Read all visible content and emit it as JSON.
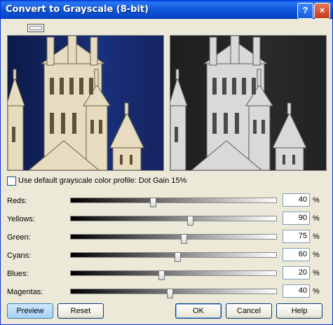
{
  "window": {
    "title": "Convert to Grayscale (8-bit)"
  },
  "title_buttons": {
    "help": "?",
    "close": "×"
  },
  "checkbox": {
    "label": "Use default grayscale color profile: Dot Gain 15%",
    "checked": false
  },
  "sliders": [
    {
      "label": "Reds:",
      "value": "40",
      "unit": "%",
      "level": 0.4
    },
    {
      "label": "Yellows:",
      "value": "90",
      "unit": "%",
      "level": 0.58
    },
    {
      "label": "Green:",
      "value": "75",
      "unit": "%",
      "level": 0.55
    },
    {
      "label": "Cyans:",
      "value": "60",
      "unit": "%",
      "level": 0.52
    },
    {
      "label": "Blues:",
      "value": "20",
      "unit": "%",
      "level": 0.44
    },
    {
      "label": "Magentas:",
      "value": "40",
      "unit": "%",
      "level": 0.48
    }
  ],
  "buttons": {
    "preview": "Preview",
    "reset": "Reset",
    "ok": "OK",
    "cancel": "Cancel",
    "help": "Help"
  },
  "colors": {
    "titlebar": "#0b56d8",
    "dialog_bg": "#ece9d8",
    "sky_color": "#19307d",
    "sky_gray": "#262626"
  }
}
